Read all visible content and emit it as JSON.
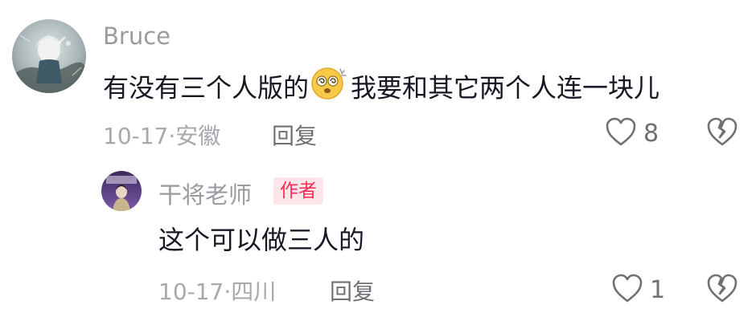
{
  "comments": [
    {
      "username": "Bruce",
      "text_before_emoji": "有没有三个人版的",
      "emoji": "dizzy-face-emoji",
      "text_after_emoji": "我要和其它两个人连一块儿",
      "timestamp": "10-17·安徽",
      "reply_label": "回复",
      "like_count": "8",
      "like_icon": "heart-outline-icon",
      "dislike_icon": "broken-heart-icon"
    },
    {
      "username": "干将老师",
      "badge": "作者",
      "text": "这个可以做三人的",
      "timestamp": "10-17·四川",
      "reply_label": "回复",
      "like_count": "1",
      "like_icon": "heart-outline-icon",
      "dislike_icon": "broken-heart-icon"
    }
  ],
  "colors": {
    "badge_text": "#fe2c55",
    "badge_bg": "#fde6ea",
    "primary_text": "#161823",
    "secondary_text": "#a8a8ae"
  }
}
